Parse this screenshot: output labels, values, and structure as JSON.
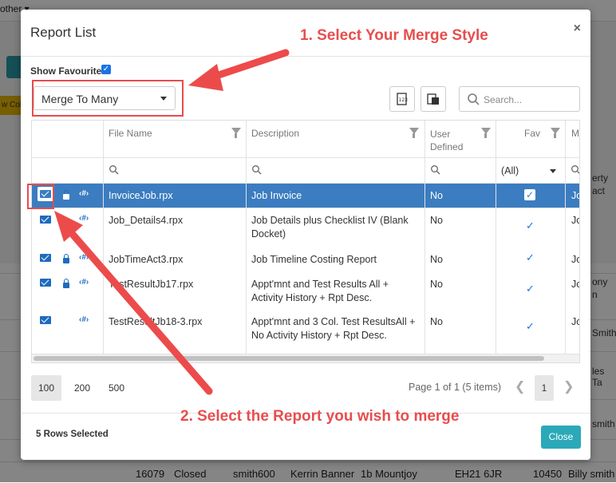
{
  "background": {
    "other_menu": "other ▾",
    "col_button": "w Col",
    "right_texts": [
      "erty",
      "act",
      "ony",
      "n",
      "Smith",
      "les Ta",
      "smith"
    ],
    "bottom_row": [
      "16079",
      "Closed",
      "smith600",
      "Kerrin Banner",
      "1b Mountjoy",
      "EH21 6JR",
      "10450",
      "Billy smith"
    ]
  },
  "modal": {
    "title": "Report List",
    "close_icon": "×",
    "show_favourites_label": "Show Favourites",
    "show_favourites_checked": true,
    "merge_select": {
      "value": "Merge To Many"
    },
    "search": {
      "placeholder": "Search..."
    },
    "columns": [
      "File Name",
      "Description",
      "User Defined",
      "Fav",
      "M"
    ],
    "fav_filter_value": "(All)",
    "rows": [
      {
        "file": "InvoiceJob.rpx",
        "desc": "Job Invoice",
        "user_defined": "No",
        "fav": true,
        "m": "Jo",
        "selected": true,
        "lock": true,
        "code": true
      },
      {
        "file": "Job_Details4.rpx",
        "desc": "Job Details plus Checklist IV (Blank Docket)",
        "user_defined": "No",
        "fav": true,
        "m": "Jo",
        "selected": false,
        "lock": false,
        "code": true
      },
      {
        "file": "JobTimeAct3.rpx",
        "desc": "Job Timeline Costing Report",
        "user_defined": "No",
        "fav": true,
        "m": "Jo",
        "selected": false,
        "lock": true,
        "code": true
      },
      {
        "file": "TestResultJb17.rpx",
        "desc": "Appt'mnt and Test Results All + Activity History + Rpt Desc.",
        "user_defined": "No",
        "fav": true,
        "m": "Jo",
        "selected": false,
        "lock": true,
        "code": true
      },
      {
        "file": "TestResultJb18-3.rpx",
        "desc": "Appt'mnt and 3 Col. Test ResultsAll + No Activity History + Rpt Desc.",
        "user_defined": "No",
        "fav": true,
        "m": "Jo",
        "selected": false,
        "lock": false,
        "code": true
      }
    ],
    "page_sizes": [
      "100",
      "200",
      "500"
    ],
    "page_info": "Page 1 of 1 (5 items)",
    "current_page": "1",
    "rows_selected": "5 Rows Selected",
    "close_label": "Close"
  },
  "annotations": {
    "step1": "1. Select Your Merge Style",
    "step2": "2. Select the Report you wish to merge"
  },
  "colors": {
    "accent": "#2ba9b8",
    "selected_row": "#3b7dc0",
    "annotation": "#e84d4d"
  }
}
